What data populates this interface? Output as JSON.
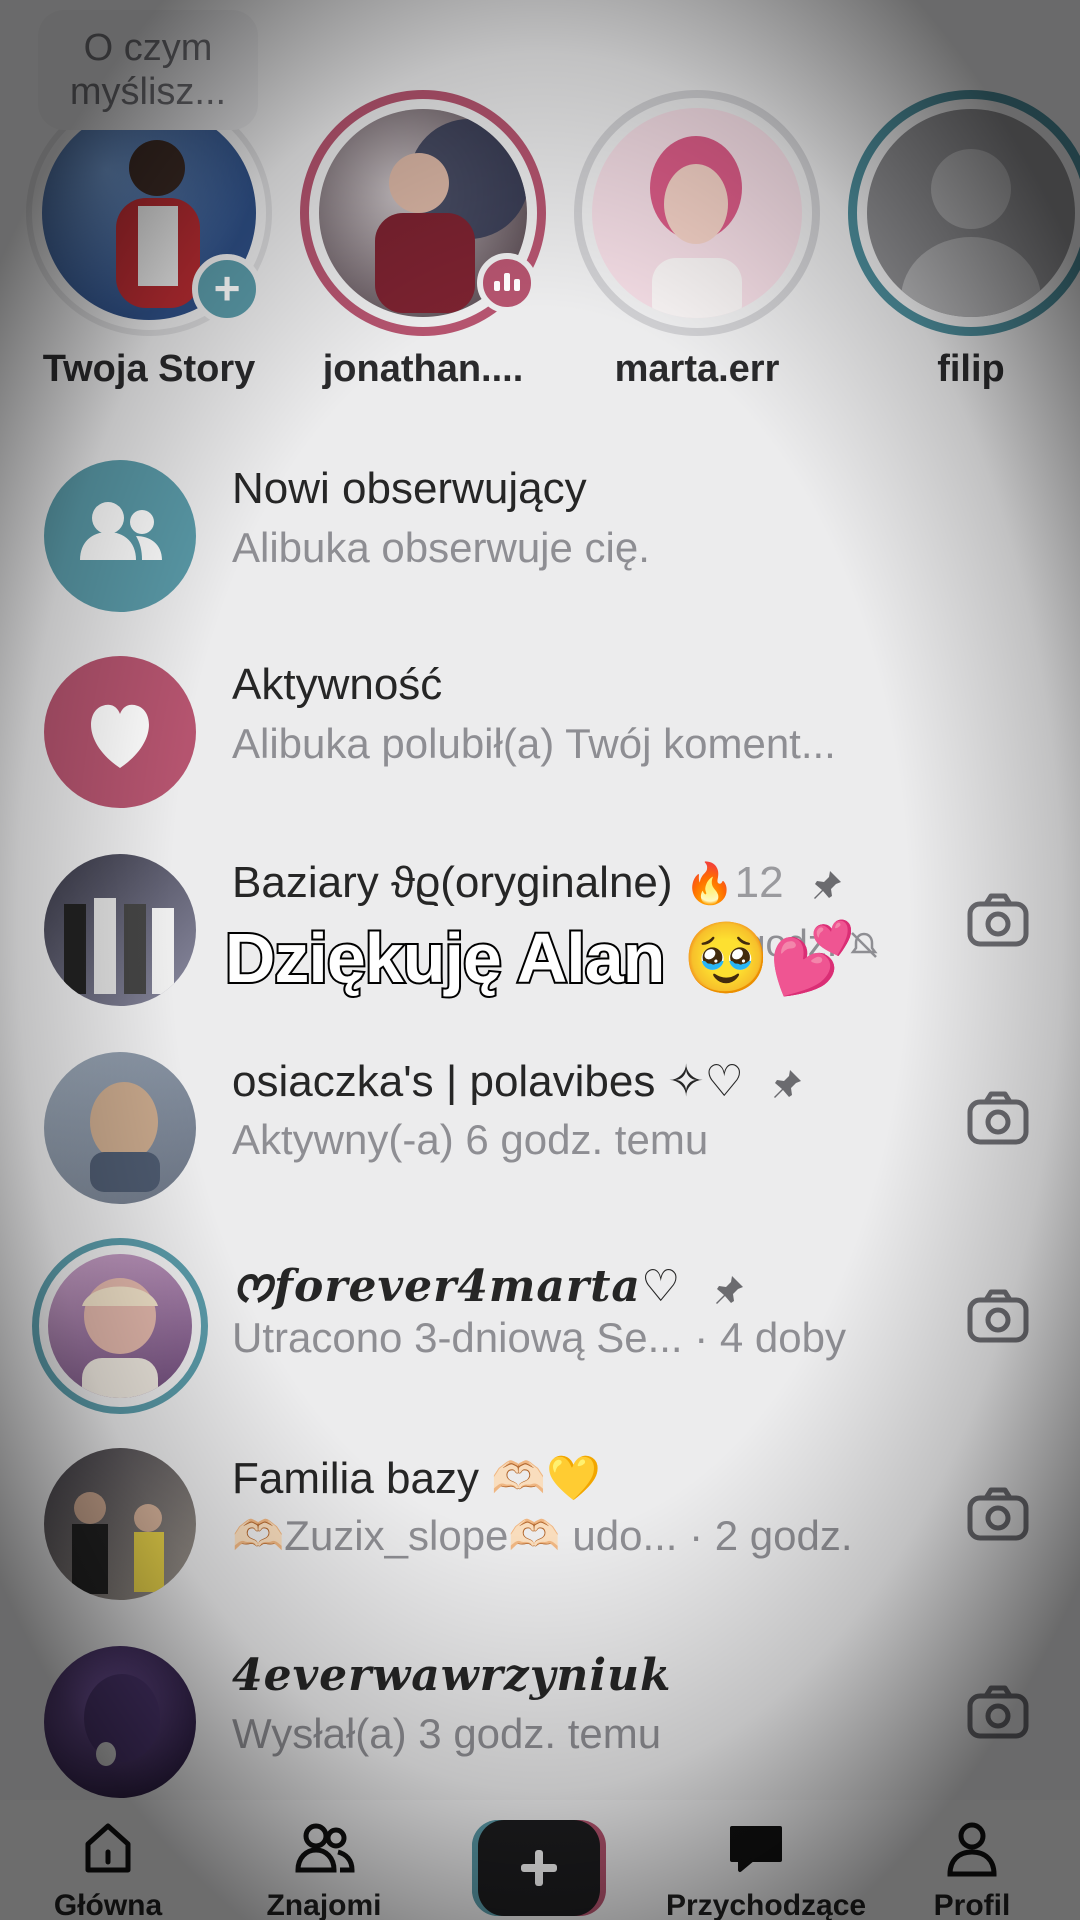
{
  "thought_bubble": {
    "text": "O czym myślisz..."
  },
  "stories": [
    {
      "label": "Twoja Story"
    },
    {
      "label": "jonathan...."
    },
    {
      "label": "marta.err"
    },
    {
      "label": "filip"
    }
  ],
  "notifications": [
    {
      "title": "Nowi obserwujący",
      "subtitle": "Alibuka obserwuje cię."
    },
    {
      "title": "Aktywność",
      "subtitle": "Alibuka polubił(a) Twój koment..."
    }
  ],
  "chats": [
    {
      "title": "Baziary ϑϱ(oryginalne)",
      "streak": "12",
      "subtitle": "·2 godz."
    },
    {
      "title": "osiaczka's | polavibes ✧♡",
      "subtitle": "Aktywny(-a) 6 godz. temu"
    },
    {
      "title": "ᰔ𝒇𝒐𝒓𝒆𝒗𝒆𝒓4𝒎𝒂𝒓𝒕𝒂♡",
      "subtitle": "Utracono 3-dniową Se... · 4 doby"
    },
    {
      "title": "Familia bazy 🫶🏻💛",
      "subtitle": "🫶🏻Zuzix_slope🫶🏻 udo... · 2 godz."
    },
    {
      "title": "4everwawrzyniuk",
      "subtitle": "Wysłał(a) 3 godz. temu"
    }
  ],
  "caption": {
    "text": "Dziękuję Alan 🥹💕"
  },
  "nav": {
    "home": "Główna",
    "friends": "Znajomi",
    "inbox": "Przychodzące",
    "profile": "Profil"
  },
  "colors": {
    "accent_teal": "#5a9aa8",
    "accent_pink": "#b5546f"
  }
}
